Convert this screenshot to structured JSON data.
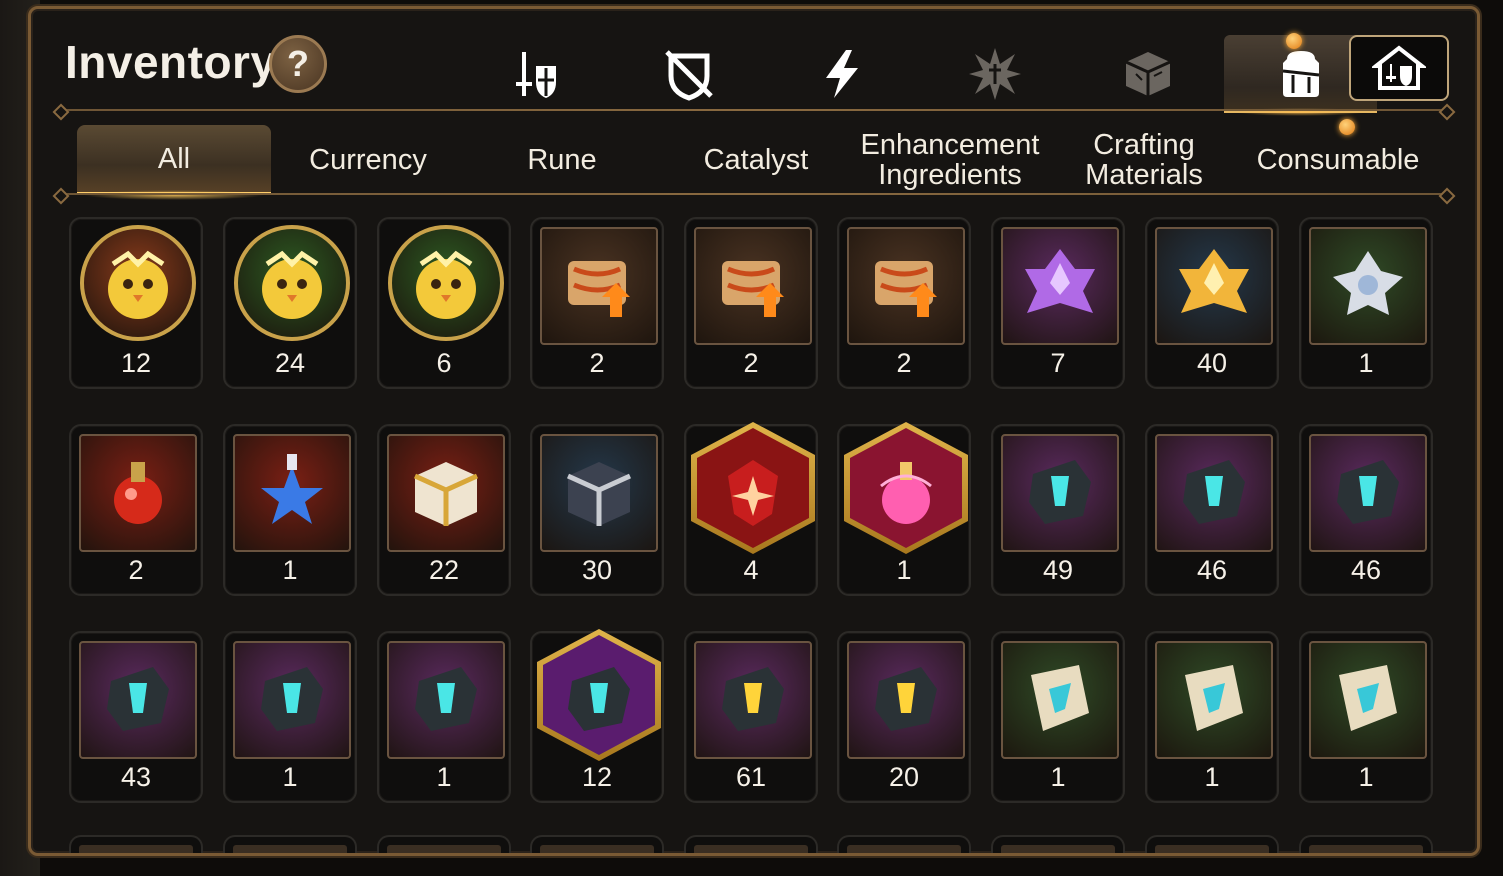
{
  "window": {
    "title": "Inventory",
    "help_label": "?"
  },
  "top_tabs": [
    {
      "name": "equipment-tab",
      "icon": "sword-shield-icon",
      "active": false
    },
    {
      "name": "artifact-tab",
      "icon": "broken-shield-icon",
      "active": false
    },
    {
      "name": "exclusive-tab",
      "icon": "lightning-icon",
      "active": false
    },
    {
      "name": "imprint-tab",
      "icon": "burst-icon",
      "active": false
    },
    {
      "name": "parts-tab",
      "icon": "cube-icon",
      "active": false
    },
    {
      "name": "bag-tab",
      "icon": "backpack-icon",
      "active": true,
      "notification": true
    }
  ],
  "guild_button": {
    "icon": "guild-hall-icon"
  },
  "category_tabs": [
    {
      "label": "All",
      "active": true
    },
    {
      "label": "Currency",
      "active": false
    },
    {
      "label": "Rune",
      "active": false
    },
    {
      "label": "Catalyst",
      "active": false
    },
    {
      "label": "Enhancement Ingredients",
      "active": false
    },
    {
      "label": "Crafting Materials",
      "active": false
    },
    {
      "label": "Consumable",
      "active": false,
      "notification": true
    }
  ],
  "items": [
    {
      "name": "golden-phantasma-token",
      "count": "12",
      "frame": "circle",
      "bg": "#8a3b1b",
      "icon": "yellow-bird-icon"
    },
    {
      "name": "green-phantasma-token",
      "count": "24",
      "frame": "circle",
      "bg": "#2d5a22",
      "icon": "yellow-bird-icon"
    },
    {
      "name": "laurel-phantasma-token",
      "count": "6",
      "frame": "circle",
      "bg": "#2d5a22",
      "icon": "yellow-bird-icon"
    },
    {
      "name": "upgrade-scroll-fire",
      "count": "2",
      "frame": "square",
      "bg": "#4a3322",
      "icon": "scroll-icon"
    },
    {
      "name": "upgrade-scroll-rainbow",
      "count": "2",
      "frame": "square",
      "bg": "#4a3322",
      "icon": "scroll-icon"
    },
    {
      "name": "upgrade-scroll-gold",
      "count": "2",
      "frame": "square",
      "bg": "#4a3322",
      "icon": "scroll-icon"
    },
    {
      "name": "purple-crystal",
      "count": "7",
      "frame": "square",
      "bg": "#5a2a5e",
      "icon": "purple-crystal-icon"
    },
    {
      "name": "gold-crystal",
      "count": "40",
      "frame": "square",
      "bg": "#24384a",
      "icon": "gold-crystal-icon"
    },
    {
      "name": "silver-flower-crystal",
      "count": "1",
      "frame": "square",
      "bg": "#2f4a26",
      "icon": "silver-flower-icon"
    },
    {
      "name": "red-potion",
      "count": "2",
      "frame": "square",
      "bg": "#7a1f14",
      "icon": "red-potion-icon"
    },
    {
      "name": "star-potion",
      "count": "1",
      "frame": "square",
      "bg": "#7a1f14",
      "icon": "star-potion-icon"
    },
    {
      "name": "gold-chest",
      "count": "22",
      "frame": "square",
      "bg": "#7a1f14",
      "icon": "gold-chest-icon"
    },
    {
      "name": "silver-chest",
      "count": "30",
      "frame": "square",
      "bg": "#24384a",
      "icon": "silver-chest-icon"
    },
    {
      "name": "red-gem",
      "count": "4",
      "frame": "hex",
      "bg": "#8a1414",
      "icon": "red-gem-icon"
    },
    {
      "name": "pink-potion",
      "count": "1",
      "frame": "hex",
      "bg": "#8a1430",
      "icon": "pink-potion-icon"
    },
    {
      "name": "rune-stone-sword",
      "count": "49",
      "frame": "square",
      "bg": "#5a2a5e",
      "icon": "rune-stone-icon"
    },
    {
      "name": "rune-stone-helm",
      "count": "46",
      "frame": "square",
      "bg": "#5a2a5e",
      "icon": "rune-stone-icon"
    },
    {
      "name": "rune-stone-armor",
      "count": "46",
      "frame": "square",
      "bg": "#5a2a5e",
      "icon": "rune-stone-icon"
    },
    {
      "name": "rune-stone-boot",
      "count": "43",
      "frame": "square",
      "bg": "#5a2a5e",
      "icon": "rune-stone-icon"
    },
    {
      "name": "rune-stone-ring",
      "count": "1",
      "frame": "square",
      "bg": "#5a2a5e",
      "icon": "rune-stone-icon"
    },
    {
      "name": "rune-stone-necklace",
      "count": "1",
      "frame": "square",
      "bg": "#5a2a5e",
      "icon": "rune-stone-icon"
    },
    {
      "name": "rune-stone-star",
      "count": "12",
      "frame": "hex",
      "bg": "#5a1c6e",
      "icon": "rune-stone-icon"
    },
    {
      "name": "gold-rune-hammer",
      "count": "61",
      "frame": "square",
      "bg": "#5a2a5e",
      "icon": "gold-rune-icon"
    },
    {
      "name": "gold-rune-slash",
      "count": "20",
      "frame": "square",
      "bg": "#5a2a5e",
      "icon": "gold-rune-icon"
    },
    {
      "name": "tablet-sword",
      "count": "1",
      "frame": "square",
      "bg": "#2f4a26",
      "icon": "tablet-icon"
    },
    {
      "name": "tablet-helm",
      "count": "1",
      "frame": "square",
      "bg": "#2f4a26",
      "icon": "tablet-icon"
    },
    {
      "name": "tablet-boot",
      "count": "1",
      "frame": "square",
      "bg": "#2f4a26",
      "icon": "tablet-icon"
    }
  ],
  "colors": {
    "accent_gold": "#e6b862",
    "panel_border": "#7a5a34",
    "notification": "#ffae3a"
  }
}
